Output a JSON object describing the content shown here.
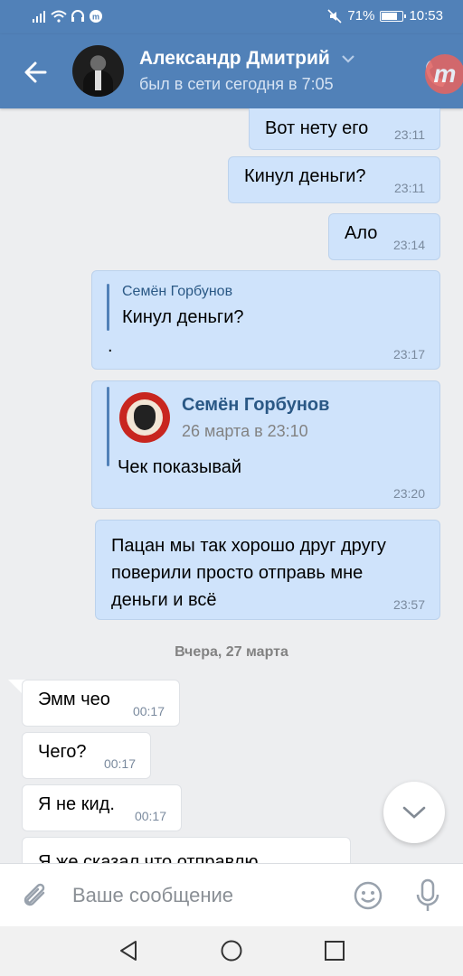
{
  "status_bar": {
    "battery": "71%",
    "battery_level": 0.71,
    "time": "10:53"
  },
  "header": {
    "contact_name": "Александр Дмитрий",
    "last_seen": "был в сети сегодня в 7:05"
  },
  "messages": [
    {
      "text": "Вот нету его",
      "time": "23:11",
      "direction": "out"
    },
    {
      "text": "Кинул деньги?",
      "time": "23:11",
      "direction": "out"
    },
    {
      "text": "Ало",
      "time": "23:14",
      "direction": "out"
    },
    {
      "reply_to_name": "Семён Горбунов",
      "reply_to_text": "Кинул деньги?",
      "text": ".",
      "time": "23:17",
      "direction": "out"
    },
    {
      "forward_name": "Семён Горбунов",
      "forward_date": "26 марта в 23:10",
      "text": "Чек показывай",
      "time": "23:20",
      "direction": "out"
    },
    {
      "text_lines": [
        "Пацан мы так хорошо друг другу",
        "поверили просто отправь мне",
        "деньги и всё"
      ],
      "time": "23:57",
      "direction": "out"
    },
    {
      "text": "Эмм чео",
      "time": "00:17",
      "direction": "in"
    },
    {
      "text": "Чего?",
      "time": "00:17",
      "direction": "in"
    },
    {
      "text": "Я не кид.",
      "time": "00:17",
      "direction": "in"
    },
    {
      "text": "Я же сказал что отправлю",
      "time": "",
      "direction": "in"
    }
  ],
  "date_separator": "Вчера, 27 марта",
  "input": {
    "placeholder": "Ваше сообщение"
  },
  "colors": {
    "header": "#5181b8",
    "outgoing_bubble": "#cfe3fb",
    "incoming_bubble": "#ffffff",
    "background": "#edeef0"
  },
  "icons": {
    "back": "arrow-left-icon",
    "dropdown": "chevron-down-icon",
    "call": "phone-icon",
    "attach": "paperclip-icon",
    "emoji": "smile-icon",
    "voice": "microphone-icon",
    "scroll": "chevron-down-icon",
    "nav_back": "triangle-back-icon",
    "nav_home": "circle-home-icon",
    "nav_recents": "square-recents-icon"
  }
}
